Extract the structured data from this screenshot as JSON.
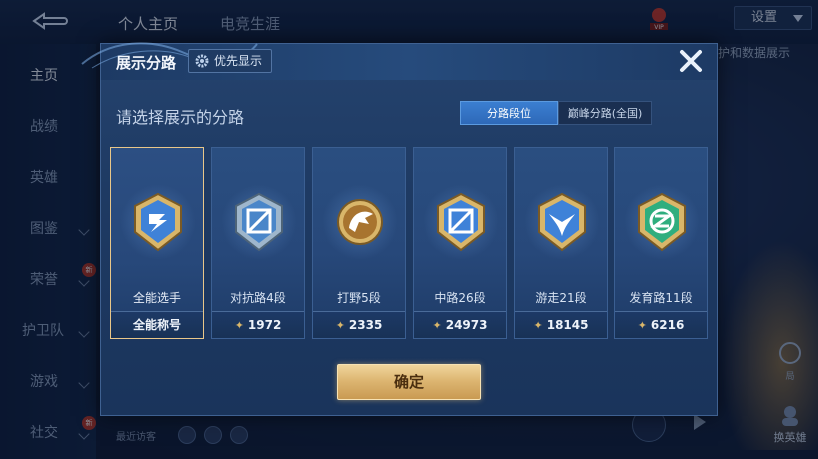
{
  "topbar": {
    "tabs": [
      "个人主页",
      "电竞生涯"
    ],
    "settings_label": "设置",
    "vip_label": "VIP",
    "behind_text": "护和数据展示"
  },
  "sidebar": {
    "items": [
      {
        "label": "主页",
        "active": true
      },
      {
        "label": "战绩"
      },
      {
        "label": "英雄"
      },
      {
        "label": "图鉴"
      },
      {
        "label": "荣誉"
      },
      {
        "label": "护卫队"
      },
      {
        "label": "游戏"
      },
      {
        "label": "社交"
      }
    ],
    "new_badge": "新"
  },
  "background": {
    "recent_visitors": "最近访客",
    "right_icon_label": "局",
    "switch_label": "换英雄"
  },
  "modal": {
    "title": "展示分路",
    "priority_label": "优先显示",
    "prompt": "请选择展示的分路",
    "segments": [
      {
        "label": "分路段位",
        "active": true
      },
      {
        "label": "巅峰分路(全国)",
        "active": false
      }
    ],
    "cards": [
      {
        "label": "全能选手",
        "foot": "全能称号",
        "selected": true,
        "badge": "all-round"
      },
      {
        "label": "对抗路4段",
        "foot": "1972",
        "selected": false,
        "badge": "clash-lane"
      },
      {
        "label": "打野5段",
        "foot": "2335",
        "selected": false,
        "badge": "jungle"
      },
      {
        "label": "中路26段",
        "foot": "24973",
        "selected": false,
        "badge": "mid-lane"
      },
      {
        "label": "游走21段",
        "foot": "18145",
        "selected": false,
        "badge": "roam"
      },
      {
        "label": "发育路11段",
        "foot": "6216",
        "selected": false,
        "badge": "farm-lane"
      }
    ],
    "confirm_label": "确定"
  },
  "colors": {
    "accent_gold": "#e9c789",
    "active_tab_blue": "#3b7fd1",
    "modal_bg": "#1e3a63"
  }
}
